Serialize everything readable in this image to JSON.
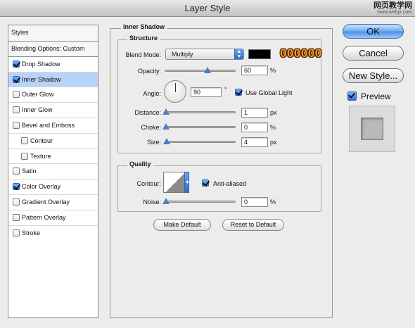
{
  "window": {
    "title": "Layer Style",
    "watermark_line1": "网页教学网",
    "watermark_line2": "www.webjx.com"
  },
  "styles_list": {
    "header": "Styles",
    "items": [
      {
        "label": "Blending Options: Custom",
        "has_checkbox": false
      },
      {
        "label": "Drop Shadow",
        "checked": true
      },
      {
        "label": "Inner Shadow",
        "checked": true,
        "selected": true
      },
      {
        "label": "Outer Glow",
        "checked": false
      },
      {
        "label": "Inner Glow",
        "checked": false
      },
      {
        "label": "Bevel and Emboss",
        "checked": false
      },
      {
        "label": "Contour",
        "checked": false,
        "sub": true
      },
      {
        "label": "Texture",
        "checked": false,
        "sub": true
      },
      {
        "label": "Satin",
        "checked": false
      },
      {
        "label": "Color Overlay",
        "checked": true
      },
      {
        "label": "Gradient Overlay",
        "checked": false
      },
      {
        "label": "Pattern Overlay",
        "checked": false
      },
      {
        "label": "Stroke",
        "checked": false
      }
    ]
  },
  "panel": {
    "title": "Inner Shadow",
    "structure": {
      "title": "Structure",
      "blend_mode_label": "Blend Mode:",
      "blend_mode_value": "Multiply",
      "color": "#000000",
      "color_annotation": "000000",
      "opacity_label": "Opacity:",
      "opacity_value": "60",
      "opacity_unit": "%",
      "opacity_level": 0.6,
      "angle_label": "Angle:",
      "angle_value": "90",
      "angle_unit": "°",
      "use_global_light_label": "Use Global Light",
      "use_global_light": true,
      "distance_label": "Distance:",
      "distance_value": "1",
      "distance_unit": "px",
      "choke_label": "Choke:",
      "choke_value": "0",
      "choke_unit": "%",
      "size_label": "Size:",
      "size_value": "4",
      "size_unit": "px"
    },
    "quality": {
      "title": "Quality",
      "contour_label": "Contour:",
      "anti_aliased_label": "Anti-aliased",
      "anti_aliased": true,
      "noise_label": "Noise:",
      "noise_value": "0",
      "noise_unit": "%"
    },
    "make_default_label": "Make Default",
    "reset_default_label": "Reset to Default"
  },
  "buttons": {
    "ok_label": "OK",
    "cancel_label": "Cancel",
    "new_style_label": "New Style...",
    "preview_label": "Preview",
    "preview_checked": true
  },
  "colors": {
    "accent": "#4b8fe6",
    "selection": "#b7d3f7",
    "annotation": "#ff9a1a"
  }
}
